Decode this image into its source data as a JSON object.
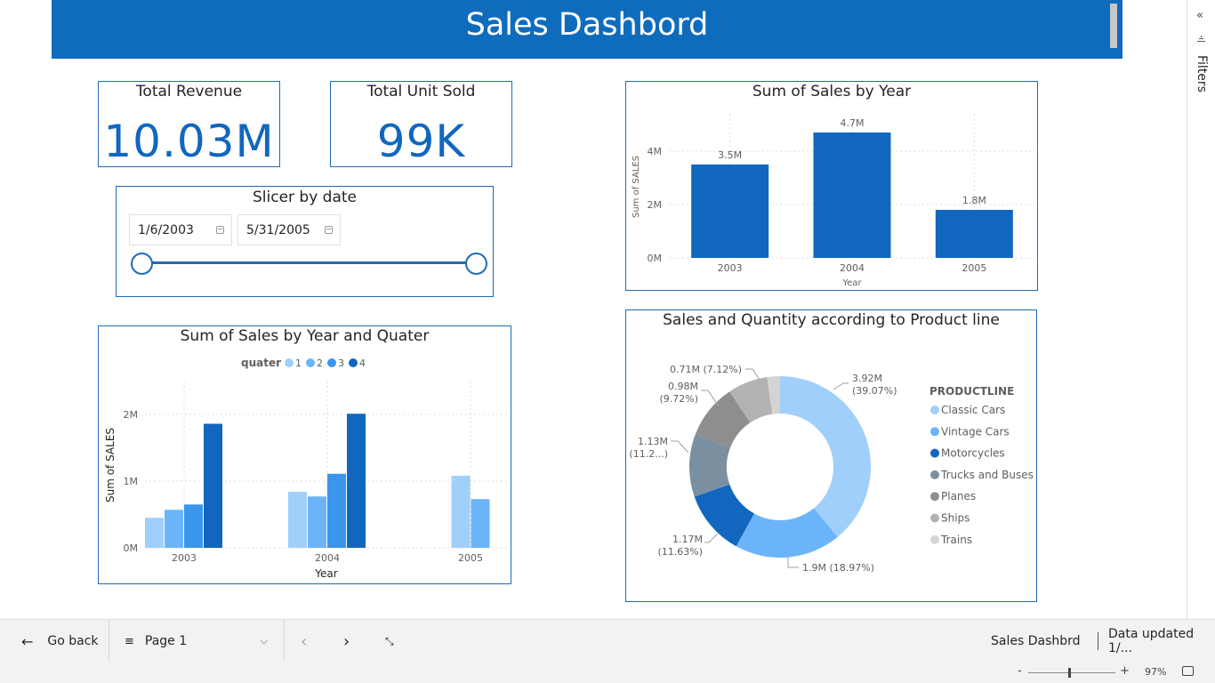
{
  "header": {
    "title": "Sales Dashbord"
  },
  "kpis": {
    "revenue": {
      "label": "Total Revenue",
      "value": "10.03M"
    },
    "units": {
      "label": "Total Unit Sold",
      "value": "99K"
    }
  },
  "slicer": {
    "title": "Slicer by date",
    "start": "1/6/2003",
    "end": "5/31/2005"
  },
  "chart_year": {
    "title": "Sum of Sales by Year",
    "ylabel": "Sum of SALES",
    "xlabel": "Year",
    "yticks": [
      "0M",
      "2M",
      "4M"
    ],
    "color": "#1167be"
  },
  "chart_quarter": {
    "title": "Sum of Sales by Year and Quater",
    "legend_title": "quater",
    "legend_items": [
      "1",
      "2",
      "3",
      "4"
    ],
    "ylabel": "Sum of SALES",
    "xlabel": "Year",
    "yticks": [
      "0M",
      "1M",
      "2M"
    ]
  },
  "chart_product": {
    "title": "Sales and Quantity according to Product line",
    "legend_title": "PRODUCTLINE",
    "slice_labels": [
      [
        "3.92M",
        "(39.07%)"
      ],
      [
        "1.9M (18.97%)"
      ],
      [
        "1.17M",
        "(11.63%)"
      ],
      [
        "1.13M",
        "(11.2...)"
      ],
      [
        "0.98M",
        "(9.72%)"
      ],
      [
        "0.71M (7.12%)"
      ]
    ]
  },
  "chart_data": [
    {
      "type": "bar",
      "title": "Sum of Sales by Year",
      "categories": [
        "2003",
        "2004",
        "2005"
      ],
      "values": [
        3.5,
        4.7,
        1.8
      ],
      "labels": [
        "3.5M",
        "4.7M",
        "1.8M"
      ],
      "xlabel": "Year",
      "ylabel": "Sum of SALES",
      "ylim": [
        0,
        5
      ],
      "grid": true
    },
    {
      "type": "bar",
      "title": "Sum of Sales by Year and Quater",
      "categories": [
        "2003",
        "2004",
        "2005"
      ],
      "series": [
        {
          "name": "1",
          "values": [
            0.45,
            0.84,
            1.08
          ],
          "color": "#a0cffc"
        },
        {
          "name": "2",
          "values": [
            0.57,
            0.77,
            0.73
          ],
          "color": "#6cb4f9"
        },
        {
          "name": "3",
          "values": [
            0.65,
            1.11,
            null
          ],
          "color": "#3a95ed"
        },
        {
          "name": "4",
          "values": [
            1.86,
            2.01,
            null
          ],
          "color": "#1167be"
        }
      ],
      "xlabel": "Year",
      "ylabel": "Sum of SALES",
      "ylim": [
        0,
        2.2
      ],
      "legend": "top",
      "grid": true
    },
    {
      "type": "pie",
      "title": "Sales and Quantity according to Product line",
      "categories": [
        "Classic Cars",
        "Vintage Cars",
        "Motorcycles",
        "Trucks and Buses",
        "Planes",
        "Ships",
        "Trains"
      ],
      "values": [
        39.07,
        18.97,
        11.63,
        11.2,
        9.72,
        7.12,
        2.29
      ],
      "colors": [
        "#a0cffc",
        "#6cb4f9",
        "#1167be",
        "#7a8fa0",
        "#8e8e8e",
        "#b3b3b3",
        "#d4d4d4"
      ],
      "legend": "right"
    }
  ],
  "bottom": {
    "go_back": "Go back",
    "page": "Page 1",
    "report_name": "Sales Dashbrd",
    "data_updated": "Data updated 1/...",
    "zoom": "97%",
    "zoom_minus": "-",
    "zoom_plus": "+"
  },
  "filters_pane": {
    "label": "Filters"
  }
}
